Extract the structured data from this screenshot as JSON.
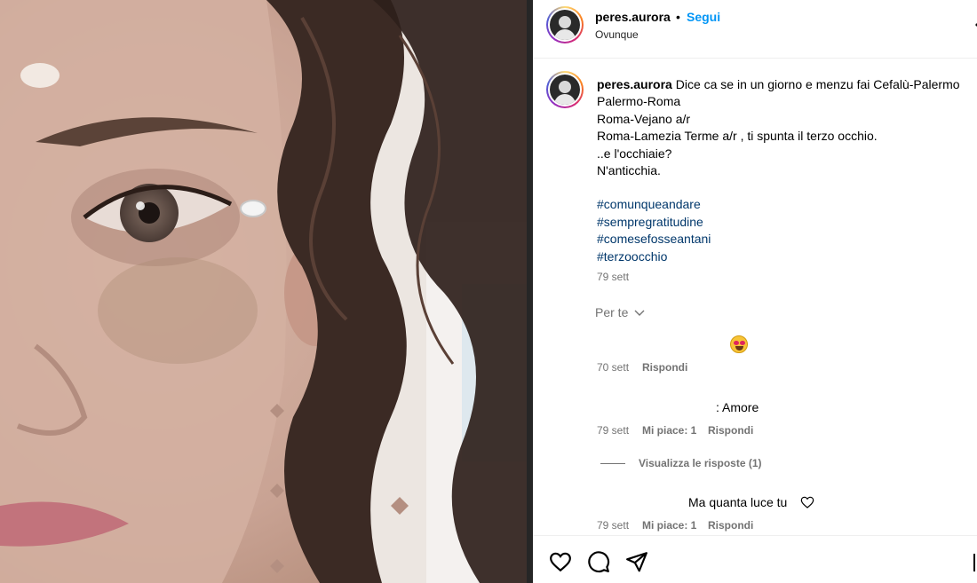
{
  "header": {
    "username": "peres.aurora",
    "separator": "•",
    "follow_label": "Segui",
    "location": "Ovunque"
  },
  "caption": {
    "username": "peres.aurora",
    "lines": [
      "Dice ca se in un giorno e menzu fai Cefalù-Palermo",
      "Palermo-Roma",
      "Roma-Vejano a/r",
      "Roma-Lamezia Terme a/r , ti spunta il terzo occhio.",
      "..e l'occhiaie?",
      "N'anticchia."
    ],
    "hashtags": [
      "#comunqueandare",
      "#sempregratitudine",
      "#comesefosseantani",
      "#terzoocchio"
    ],
    "time": "79 sett"
  },
  "translate_label": "Per te",
  "comments": [
    {
      "emoji": "smiling-face-with-heart-eyes",
      "time": "70 sett",
      "reply_label": "Rispondi"
    },
    {
      "text": ": Amore",
      "time": "79 sett",
      "likes_label": "Mi piace: 1",
      "reply_label": "Rispondi",
      "view_replies_label": "Visualizza le risposte (1)"
    },
    {
      "text": "Ma quanta luce tu",
      "time": "79 sett",
      "likes_label": "Mi piace: 1",
      "reply_label": "Rispondi"
    }
  ],
  "icons": {
    "like": "heart-icon",
    "comment": "comment-icon",
    "share": "share-icon",
    "more": "more-icon"
  },
  "colors": {
    "link_blue": "#0095f6",
    "hashtag": "#00376b",
    "secondary_text": "#737373"
  }
}
